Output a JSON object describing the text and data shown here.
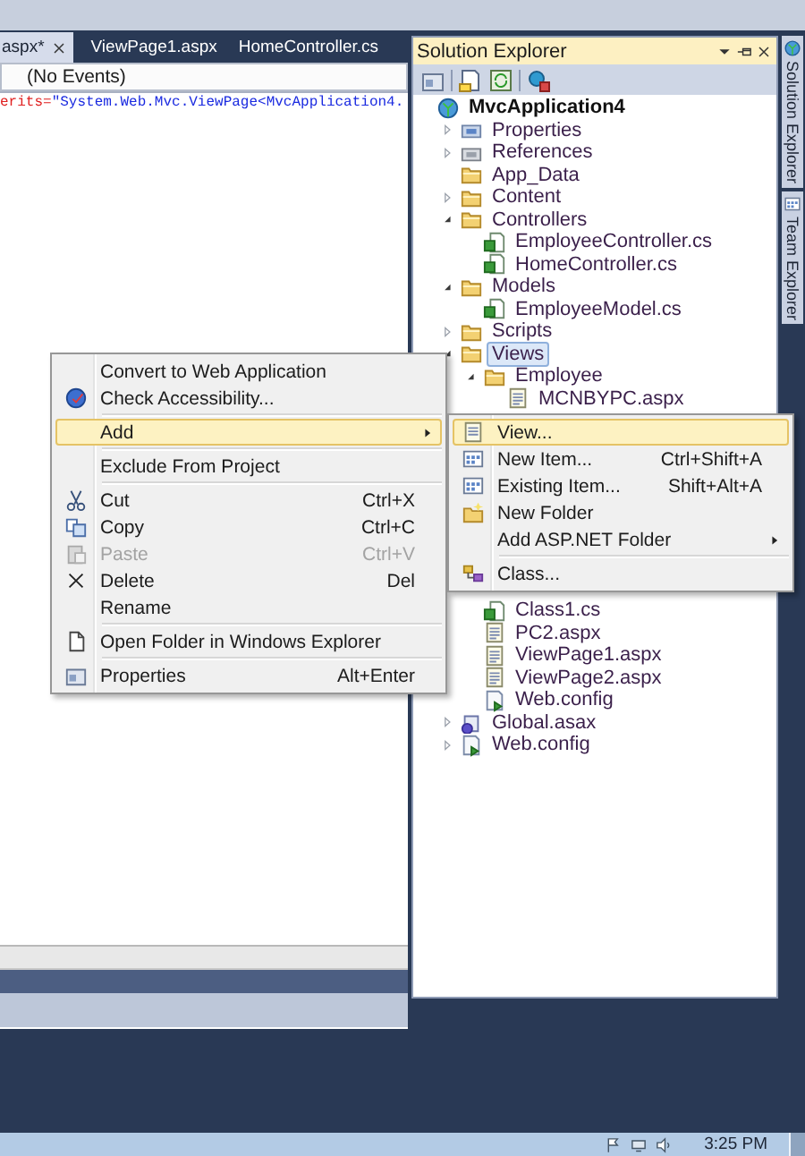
{
  "editor": {
    "tabs": [
      {
        "label": "aspx*",
        "selected": true
      },
      {
        "label": "ViewPage1.aspx",
        "selected": false
      },
      {
        "label": "HomeController.cs",
        "selected": false
      }
    ],
    "events_dropdown": "(No Events)",
    "code_line": [
      {
        "text": "erits=",
        "kind": "attribute"
      },
      {
        "text": "\"System.Web.Mvc.ViewPage<MvcApplication4.",
        "kind": "string"
      }
    ]
  },
  "solution_explorer": {
    "title": "Solution Explorer",
    "tree": [
      {
        "label": "MvcApplication4",
        "kind": "project",
        "selected": false,
        "children": [
          {
            "label": "Properties",
            "kind": "properties",
            "expanded": false,
            "selected": false
          },
          {
            "label": "References",
            "kind": "references",
            "expanded": false,
            "selected": false
          },
          {
            "label": "App_Data",
            "kind": "folder",
            "selected": false
          },
          {
            "label": "Content",
            "kind": "folder",
            "expanded": false,
            "selected": false
          },
          {
            "label": "Controllers",
            "kind": "folder",
            "expanded": true,
            "selected": false,
            "children": [
              {
                "label": "EmployeeController.cs",
                "kind": "cs",
                "selected": false
              },
              {
                "label": "HomeController.cs",
                "kind": "cs",
                "selected": false
              }
            ]
          },
          {
            "label": "Models",
            "kind": "folder",
            "expanded": true,
            "selected": false,
            "children": [
              {
                "label": "EmployeeModel.cs",
                "kind": "cs",
                "selected": false
              }
            ]
          },
          {
            "label": "Scripts",
            "kind": "folder",
            "expanded": false,
            "selected": false
          },
          {
            "label": "Views",
            "kind": "folder",
            "expanded": true,
            "selected": true,
            "children": [
              {
                "label": "Employee",
                "kind": "folder",
                "expanded": true,
                "selected": false,
                "children": [
                  {
                    "label": "MCNBYPC.aspx",
                    "kind": "aspx",
                    "selected": false
                  }
                ]
              },
              {
                "label": "Class1.cs",
                "kind": "cs",
                "selected": false,
                "covered_above": true
              },
              {
                "label": "PC2.aspx",
                "kind": "aspx",
                "selected": false
              },
              {
                "label": "ViewPage1.aspx",
                "kind": "aspx",
                "selected": false
              },
              {
                "label": "ViewPage2.aspx",
                "kind": "aspx",
                "selected": false
              },
              {
                "label": "Web.config",
                "kind": "config",
                "selected": false
              }
            ]
          },
          {
            "label": "Global.asax",
            "kind": "asax",
            "expanded": false,
            "selected": false
          },
          {
            "label": "Web.config",
            "kind": "config",
            "expanded": false,
            "selected": false
          }
        ]
      }
    ]
  },
  "side_tabs": [
    {
      "label": "Solution Explorer"
    },
    {
      "label": "Team Explorer"
    }
  ],
  "context_menu": {
    "items": [
      {
        "kind": "item",
        "label": "Convert to Web Application",
        "selected": false,
        "disabled": false,
        "submenu": false
      },
      {
        "kind": "item",
        "label": "Check Accessibility...",
        "selected": false,
        "disabled": false,
        "submenu": false
      },
      {
        "kind": "separator"
      },
      {
        "kind": "item",
        "label": "Add",
        "selected": true,
        "disabled": false,
        "submenu": true
      },
      {
        "kind": "separator"
      },
      {
        "kind": "item",
        "label": "Exclude From Project",
        "selected": false,
        "disabled": false,
        "submenu": false
      },
      {
        "kind": "separator"
      },
      {
        "kind": "item",
        "label": "Cut",
        "shortcut": "Ctrl+X",
        "selected": false,
        "disabled": false,
        "submenu": false
      },
      {
        "kind": "item",
        "label": "Copy",
        "shortcut": "Ctrl+C",
        "selected": false,
        "disabled": false,
        "submenu": false
      },
      {
        "kind": "item",
        "label": "Paste",
        "shortcut": "Ctrl+V",
        "selected": false,
        "disabled": true,
        "submenu": false
      },
      {
        "kind": "item",
        "label": "Delete",
        "shortcut": "Del",
        "selected": false,
        "disabled": false,
        "submenu": false
      },
      {
        "kind": "item",
        "label": "Rename",
        "selected": false,
        "disabled": false,
        "submenu": false
      },
      {
        "kind": "separator"
      },
      {
        "kind": "item",
        "label": "Open Folder in Windows Explorer",
        "selected": false,
        "disabled": false,
        "submenu": false
      },
      {
        "kind": "separator"
      },
      {
        "kind": "item",
        "label": "Properties",
        "shortcut": "Alt+Enter",
        "selected": false,
        "disabled": false,
        "submenu": false
      }
    ]
  },
  "submenu": {
    "items": [
      {
        "kind": "item",
        "label": "View...",
        "selected": true,
        "disabled": false,
        "submenu": false
      },
      {
        "kind": "item",
        "label": "New Item...",
        "shortcut": "Ctrl+Shift+A",
        "selected": false,
        "disabled": false,
        "submenu": false
      },
      {
        "kind": "item",
        "label": "Existing Item...",
        "shortcut": "Shift+Alt+A",
        "selected": false,
        "disabled": false,
        "submenu": false
      },
      {
        "kind": "item",
        "label": "New Folder",
        "selected": false,
        "disabled": false,
        "submenu": false
      },
      {
        "kind": "item",
        "label": "Add ASP.NET Folder",
        "selected": false,
        "disabled": false,
        "submenu": true
      },
      {
        "kind": "separator"
      },
      {
        "kind": "item",
        "label": "Class...",
        "selected": false,
        "disabled": false,
        "submenu": false
      }
    ]
  },
  "taskbar": {
    "clock": "3:25 PM"
  }
}
